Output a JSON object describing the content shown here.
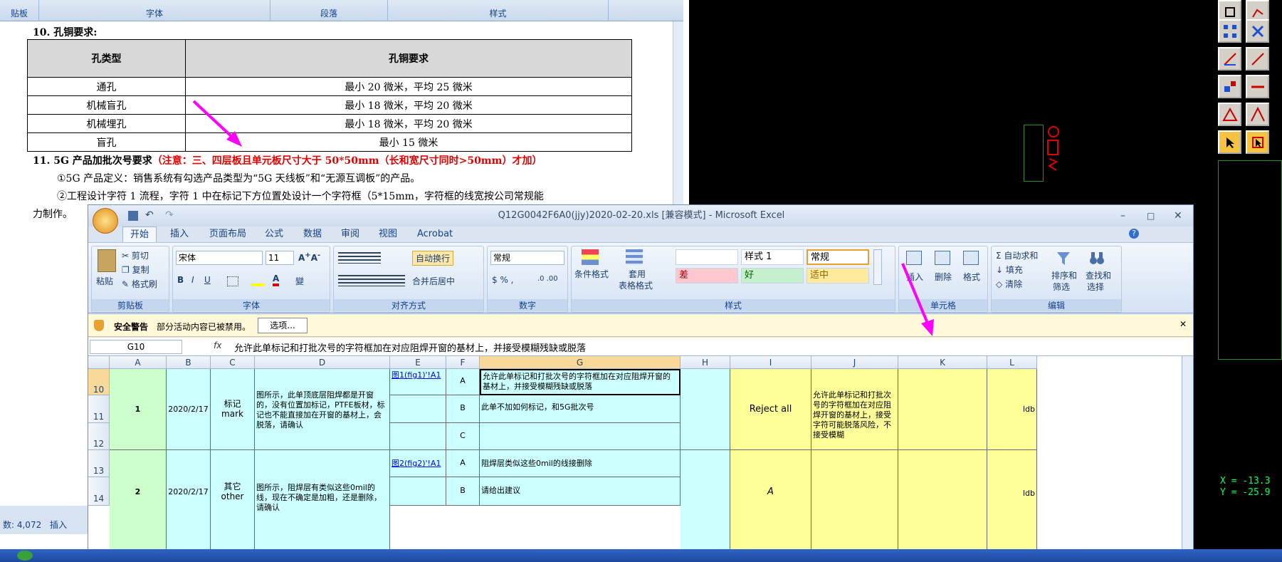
{
  "word": {
    "ribbon_groups": [
      "贴板",
      "字体",
      "段落",
      "样式"
    ],
    "heading10": "10.  孔铜要求:",
    "table_headers": [
      "孔类型",
      "孔铜要求"
    ],
    "table_rows": [
      [
        "通孔",
        "最小 20 微米，平均 25 微米"
      ],
      [
        "机械盲孔",
        "最小 18 微米，平均 20 微米"
      ],
      [
        "机械埋孔",
        "最小 18 微米，平均 20 微米"
      ],
      [
        "盲孔",
        "最小 15 微米"
      ]
    ],
    "heading11_black": "11.  5G 产品加批次号要求",
    "heading11_red": "（注意：三、四层板且单元板尺寸大于 50*50mm（长和宽尺寸同时>50mm）才加）",
    "para1": "①5G 产品定义：销售系统有勾选产品类型为“5G 天线板”和“无源互调板”的产品。",
    "para2": "②工程设计字符 1 流程，字符 1 中在标记下方位置处设计一个字符框（5*15mm，字符框的线宽按公司常规能",
    "para3": "力制作。",
    "status_words": "数: 4,072",
    "status_insert": "插入"
  },
  "cad": {
    "coord_x": "X = -13.3",
    "coord_y": "Y = -25.9"
  },
  "excel": {
    "title": "Q12G0042F6A0(jjy)2020-02-20.xls  [兼容模式] - Microsoft Excel",
    "tabs": [
      "开始",
      "插入",
      "页面布局",
      "公式",
      "数据",
      "审阅",
      "视图",
      "Acrobat"
    ],
    "clipboard": {
      "paste": "粘贴",
      "cut": "剪切",
      "copy": "复制",
      "format_painter": "格式刷",
      "label": "剪贴板"
    },
    "font": {
      "name": "宋体",
      "size": "11",
      "label": "字体"
    },
    "align": {
      "wrap": "自动换行",
      "merge": "合并后居中",
      "label": "对齐方式"
    },
    "number": {
      "format": "常规",
      "label": "数字"
    },
    "styles": {
      "cond": "条件格式",
      "table": "套用",
      "table2": "表格格式",
      "style1": "样式 1",
      "normal": "常规",
      "bad": "差",
      "good": "好",
      "neutral": "适中",
      "label": "样式"
    },
    "cells": {
      "insert": "插入",
      "delete": "删除",
      "format": "格式",
      "label": "单元格"
    },
    "edit": {
      "autosum": "自动求和",
      "fill": "填充",
      "clear": "清除",
      "sort": "排序和",
      "sort2": "筛选",
      "find": "查找和",
      "find2": "选择",
      "label": "编辑"
    },
    "security": {
      "title": "安全警告",
      "msg": "部分活动内容已被禁用。",
      "button": "选项..."
    },
    "name_box": "G10",
    "fx": "fx",
    "formula": "允许此单标记和打批次号的字符框加在对应阻焊开窗的基材上，并接受模糊残缺或脱落",
    "columns": [
      "A",
      "B",
      "C",
      "D",
      "E",
      "F",
      "G",
      "H",
      "I",
      "J",
      "K",
      "L"
    ],
    "rows": [
      "10",
      "11",
      "12",
      "13",
      "14"
    ],
    "r1": {
      "a": "1",
      "b": "2020/2/17",
      "c1": "标记",
      "c2": "mark",
      "d": "图所示，此单顶底层阻焊都是开窗的，没有位置加标记，PTFE板材，标记也不能直接加在开窗的基材上，会脱落，请确认",
      "e": "图1(fig1)'!A1",
      "fa": "A",
      "fb": "B",
      "fc": "C",
      "ga": "允许此单标记和打批次号的字符框加在对应阻焊开窗的基材上，并接受模糊残缺或脱落",
      "gb": "此单不加如何标记，和5G批次号",
      "i": "Reject all",
      "j": "允许此单标记和打批次号的字符框加在对应阻焊开窗的基材上，接受字符可能脱落风险，不接受模糊",
      "l": "ldb"
    },
    "r2": {
      "a": "2",
      "b": "2020/2/17",
      "c1": "其它",
      "c2": "other",
      "d": "图所示，阻焊层有类似这些0mil的线，现在不确定是加粗，还是删除，请确认",
      "e": "图2(fig2)'!A1",
      "fa": "A",
      "fb": "B",
      "ga": "阻焊层类似这些0mil的线接删除",
      "gb": "请给出建议",
      "i": "A",
      "l": "ldb"
    }
  }
}
